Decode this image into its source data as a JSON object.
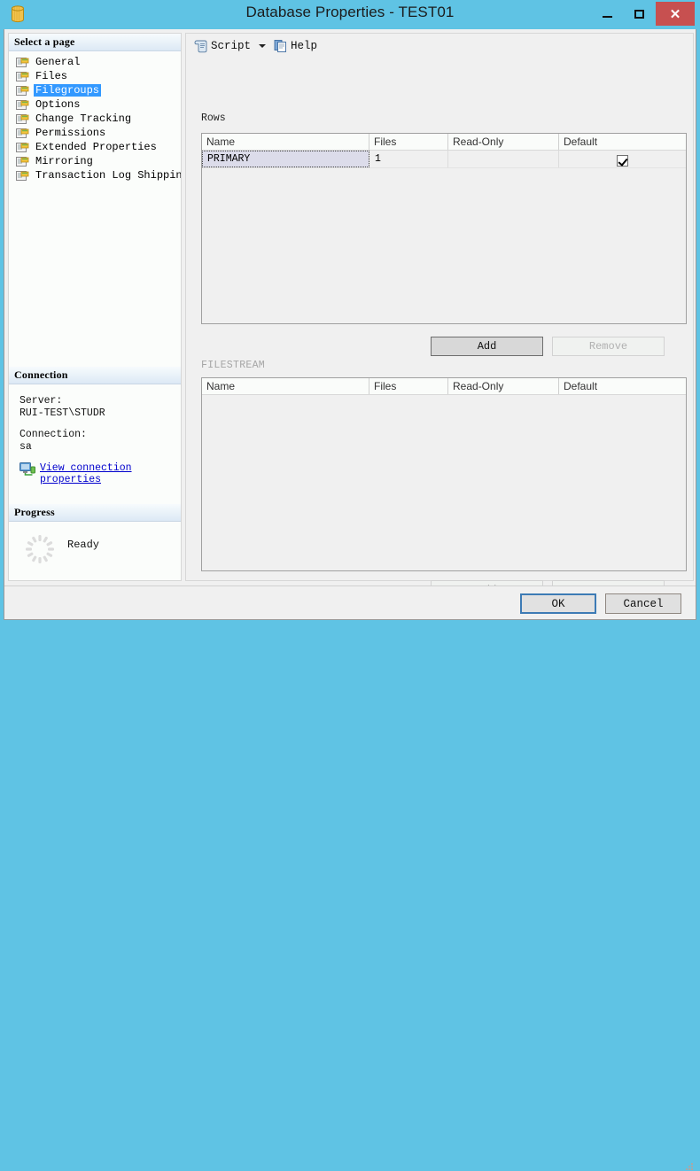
{
  "window": {
    "title": "Database Properties - TEST01",
    "icon": "database-cylinder-icon",
    "minimize_label": "–",
    "maximize_label": "□",
    "close_label": "✕"
  },
  "sidebar": {
    "header": "Select a page",
    "items": [
      {
        "label": "General",
        "selected": false,
        "icon": "page-icon"
      },
      {
        "label": "Files",
        "selected": false,
        "icon": "page-icon"
      },
      {
        "label": "Filegroups",
        "selected": true,
        "icon": "page-icon"
      },
      {
        "label": "Options",
        "selected": false,
        "icon": "page-icon"
      },
      {
        "label": "Change Tracking",
        "selected": false,
        "icon": "page-icon"
      },
      {
        "label": "Permissions",
        "selected": false,
        "icon": "page-icon"
      },
      {
        "label": "Extended Properties",
        "selected": false,
        "icon": "page-icon"
      },
      {
        "label": "Mirroring",
        "selected": false,
        "icon": "page-icon"
      },
      {
        "label": "Transaction Log Shipping",
        "selected": false,
        "icon": "page-icon"
      }
    ]
  },
  "connection": {
    "header": "Connection",
    "server_label": "Server:",
    "server_value": "RUI-TEST\\STUDR",
    "connection_label": "Connection:",
    "connection_value": "sa",
    "view_link_line1": "View connection",
    "view_link_line2": "properties",
    "view_link_icon": "computer-connection-icon"
  },
  "progress": {
    "header": "Progress",
    "status": "Ready",
    "icon": "progress-spinner-icon"
  },
  "toolbar": {
    "script_label": "Script",
    "script_icon": "script-scroll-icon",
    "dropdown_icon": "chevron-down-icon",
    "help_label": "Help",
    "help_icon": "help-pages-icon"
  },
  "rows_section": {
    "label": "Rows",
    "columns": [
      "Name",
      "Files",
      "Read-Only",
      "Default"
    ],
    "rows": [
      {
        "name": "PRIMARY",
        "files": "1",
        "read_only": "",
        "default_checked": true,
        "selected": true
      }
    ],
    "add_label": "Add",
    "remove_label": "Remove",
    "add_enabled": true,
    "remove_enabled": false
  },
  "filestream_section": {
    "label": "FILESTREAM",
    "columns": [
      "Name",
      "Files",
      "Read-Only",
      "Default"
    ],
    "rows": [],
    "add_label": "Add",
    "remove_label": "Remove",
    "add_enabled": false,
    "remove_enabled": false
  },
  "footer": {
    "ok_label": "OK",
    "cancel_label": "Cancel"
  },
  "colors": {
    "titlebar": "#5fc3e4",
    "close_button": "#c75050",
    "selection": "#3399ff",
    "link": "#0000cd",
    "ok_focus_border": "#3d7bb5"
  }
}
